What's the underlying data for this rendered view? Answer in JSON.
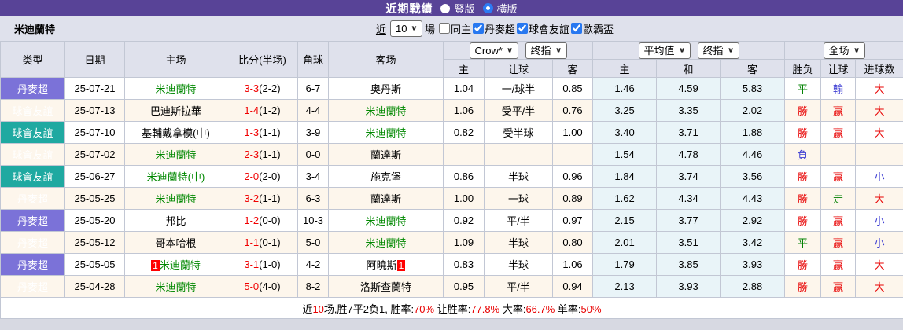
{
  "title_bar": {
    "title": "近期戰績",
    "radio_vertical_label": "豎版",
    "radio_horizontal_label": "橫版",
    "selected_layout": "橫版"
  },
  "filter_bar": {
    "team": "米迪蘭特",
    "near_label": "近",
    "games_value": "10",
    "games_suffix": "場",
    "checkboxes": [
      {
        "label": "同主",
        "checked": false
      },
      {
        "label": "丹麥超",
        "checked": true
      },
      {
        "label": "球會友誼",
        "checked": true
      },
      {
        "label": "歐霸盃",
        "checked": true
      }
    ]
  },
  "table": {
    "col_headers_left": [
      "类型",
      "日期",
      "主场",
      "比分(半场)",
      "角球",
      "客场"
    ],
    "odds_provider_select": "Crow*",
    "odds_final_select": "终指",
    "avg_provider_select": "平均值",
    "avg_final_select": "终指",
    "fulltime_select": "全场",
    "sub_headers": [
      "主",
      "让球",
      "客",
      "主",
      "和",
      "客",
      "胜负",
      "让球",
      "进球数"
    ],
    "rows": [
      {
        "league": "丹麥超",
        "league_color": "purple",
        "date": "25-07-21",
        "home": "米迪蘭特",
        "home_green": true,
        "home_badge": "",
        "score": "3-3",
        "half": "(2-2)",
        "corner": "6-7",
        "away": "奧丹斯",
        "away_green": false,
        "away_badge": "",
        "odds_home": "1.04",
        "handicap": "一/球半",
        "odds_away": "0.85",
        "avg_home": "1.46",
        "avg_draw": "4.59",
        "avg_away": "5.83",
        "result": "平",
        "result_c": "green",
        "hresult": "輸",
        "hresult_c": "blue",
        "goals": "大",
        "goals_c": "red"
      },
      {
        "league": "球會友誼",
        "league_color": "teal",
        "date": "25-07-13",
        "home": "巴迪斯拉華",
        "home_green": false,
        "home_badge": "",
        "score": "1-4",
        "half": "(1-2)",
        "corner": "4-4",
        "away": "米迪蘭特",
        "away_green": true,
        "away_badge": "",
        "odds_home": "1.06",
        "handicap": "受平/半",
        "odds_away": "0.76",
        "avg_home": "3.25",
        "avg_draw": "3.35",
        "avg_away": "2.02",
        "result": "勝",
        "result_c": "red",
        "hresult": "赢",
        "hresult_c": "red",
        "goals": "大",
        "goals_c": "red"
      },
      {
        "league": "球會友誼",
        "league_color": "teal",
        "date": "25-07-10",
        "home": "基輔戴拿模(中)",
        "home_green": false,
        "home_badge": "",
        "score": "1-3",
        "half": "(1-1)",
        "corner": "3-9",
        "away": "米迪蘭特",
        "away_green": true,
        "away_badge": "",
        "odds_home": "0.82",
        "handicap": "受半球",
        "odds_away": "1.00",
        "avg_home": "3.40",
        "avg_draw": "3.71",
        "avg_away": "1.88",
        "result": "勝",
        "result_c": "red",
        "hresult": "赢",
        "hresult_c": "red",
        "goals": "大",
        "goals_c": "red"
      },
      {
        "league": "球會友誼",
        "league_color": "teal",
        "date": "25-07-02",
        "home": "米迪蘭特",
        "home_green": true,
        "home_badge": "",
        "score": "2-3",
        "half": "(1-1)",
        "corner": "0-0",
        "away": "蘭達斯",
        "away_green": false,
        "away_badge": "",
        "odds_home": "",
        "handicap": "",
        "odds_away": "",
        "avg_home": "1.54",
        "avg_draw": "4.78",
        "avg_away": "4.46",
        "result": "負",
        "result_c": "blue",
        "hresult": "",
        "hresult_c": "",
        "goals": "",
        "goals_c": ""
      },
      {
        "league": "球會友誼",
        "league_color": "teal",
        "date": "25-06-27",
        "home": "米迪蘭特(中)",
        "home_green": true,
        "home_badge": "",
        "score": "2-0",
        "half": "(2-0)",
        "corner": "3-4",
        "away": "施克堡",
        "away_green": false,
        "away_badge": "",
        "odds_home": "0.86",
        "handicap": "半球",
        "odds_away": "0.96",
        "avg_home": "1.84",
        "avg_draw": "3.74",
        "avg_away": "3.56",
        "result": "勝",
        "result_c": "red",
        "hresult": "赢",
        "hresult_c": "red",
        "goals": "小",
        "goals_c": "blue"
      },
      {
        "league": "丹麥超",
        "league_color": "purple",
        "date": "25-05-25",
        "home": "米迪蘭特",
        "home_green": true,
        "home_badge": "",
        "score": "3-2",
        "half": "(1-1)",
        "corner": "6-3",
        "away": "蘭達斯",
        "away_green": false,
        "away_badge": "",
        "odds_home": "1.00",
        "handicap": "一球",
        "odds_away": "0.89",
        "avg_home": "1.62",
        "avg_draw": "4.34",
        "avg_away": "4.43",
        "result": "勝",
        "result_c": "red",
        "hresult": "走",
        "hresult_c": "green",
        "goals": "大",
        "goals_c": "red"
      },
      {
        "league": "丹麥超",
        "league_color": "purple",
        "date": "25-05-20",
        "home": "邦比",
        "home_green": false,
        "home_badge": "",
        "score": "1-2",
        "half": "(0-0)",
        "corner": "10-3",
        "away": "米迪蘭特",
        "away_green": true,
        "away_badge": "",
        "odds_home": "0.92",
        "handicap": "平/半",
        "odds_away": "0.97",
        "avg_home": "2.15",
        "avg_draw": "3.77",
        "avg_away": "2.92",
        "result": "勝",
        "result_c": "red",
        "hresult": "赢",
        "hresult_c": "red",
        "goals": "小",
        "goals_c": "blue"
      },
      {
        "league": "丹麥超",
        "league_color": "purple",
        "date": "25-05-12",
        "home": "哥本哈根",
        "home_green": false,
        "home_badge": "",
        "score": "1-1",
        "half": "(0-1)",
        "corner": "5-0",
        "away": "米迪蘭特",
        "away_green": true,
        "away_badge": "",
        "odds_home": "1.09",
        "handicap": "半球",
        "odds_away": "0.80",
        "avg_home": "2.01",
        "avg_draw": "3.51",
        "avg_away": "3.42",
        "result": "平",
        "result_c": "green",
        "hresult": "赢",
        "hresult_c": "red",
        "goals": "小",
        "goals_c": "blue"
      },
      {
        "league": "丹麥超",
        "league_color": "purple",
        "date": "25-05-05",
        "home": "米迪蘭特",
        "home_green": true,
        "home_badge": "1",
        "score": "3-1",
        "half": "(1-0)",
        "corner": "4-2",
        "away": "阿曉斯",
        "away_green": false,
        "away_badge": "1",
        "odds_home": "0.83",
        "handicap": "半球",
        "odds_away": "1.06",
        "avg_home": "1.79",
        "avg_draw": "3.85",
        "avg_away": "3.93",
        "result": "勝",
        "result_c": "red",
        "hresult": "赢",
        "hresult_c": "red",
        "goals": "大",
        "goals_c": "red"
      },
      {
        "league": "丹麥超",
        "league_color": "purple",
        "date": "25-04-28",
        "home": "米迪蘭特",
        "home_green": true,
        "home_badge": "",
        "score": "5-0",
        "half": "(4-0)",
        "corner": "8-2",
        "away": "洛斯查蘭特",
        "away_green": false,
        "away_badge": "",
        "odds_home": "0.95",
        "handicap": "平/半",
        "odds_away": "0.94",
        "avg_home": "2.13",
        "avg_draw": "3.93",
        "avg_away": "2.88",
        "result": "勝",
        "result_c": "red",
        "hresult": "赢",
        "hresult_c": "red",
        "goals": "大",
        "goals_c": "red"
      }
    ]
  },
  "footer": {
    "segments": [
      {
        "t": "近",
        "c": "black"
      },
      {
        "t": "10",
        "c": "red"
      },
      {
        "t": "场,胜7平2负1, 胜率:",
        "c": "black"
      },
      {
        "t": "70%",
        "c": "red"
      },
      {
        "t": " 让胜率:",
        "c": "black"
      },
      {
        "t": "77.8%",
        "c": "red"
      },
      {
        "t": " 大率:",
        "c": "black"
      },
      {
        "t": "66.7%",
        "c": "red"
      },
      {
        "t": " 单率:",
        "c": "black"
      },
      {
        "t": "50%",
        "c": "red"
      }
    ]
  },
  "colors": {
    "titlebar_bg": "#584397",
    "header_bg": "#dfe1ec",
    "league_purple": "#7b72d8",
    "league_teal": "#1fa9a1",
    "row_alt_bg": "#fdf6ec",
    "avg_col_bg": "#e9f4f8",
    "text_red": "#e80000",
    "text_green": "#008800",
    "text_blue": "#3c3cd2",
    "radio_accent": "#2d7bf4"
  }
}
